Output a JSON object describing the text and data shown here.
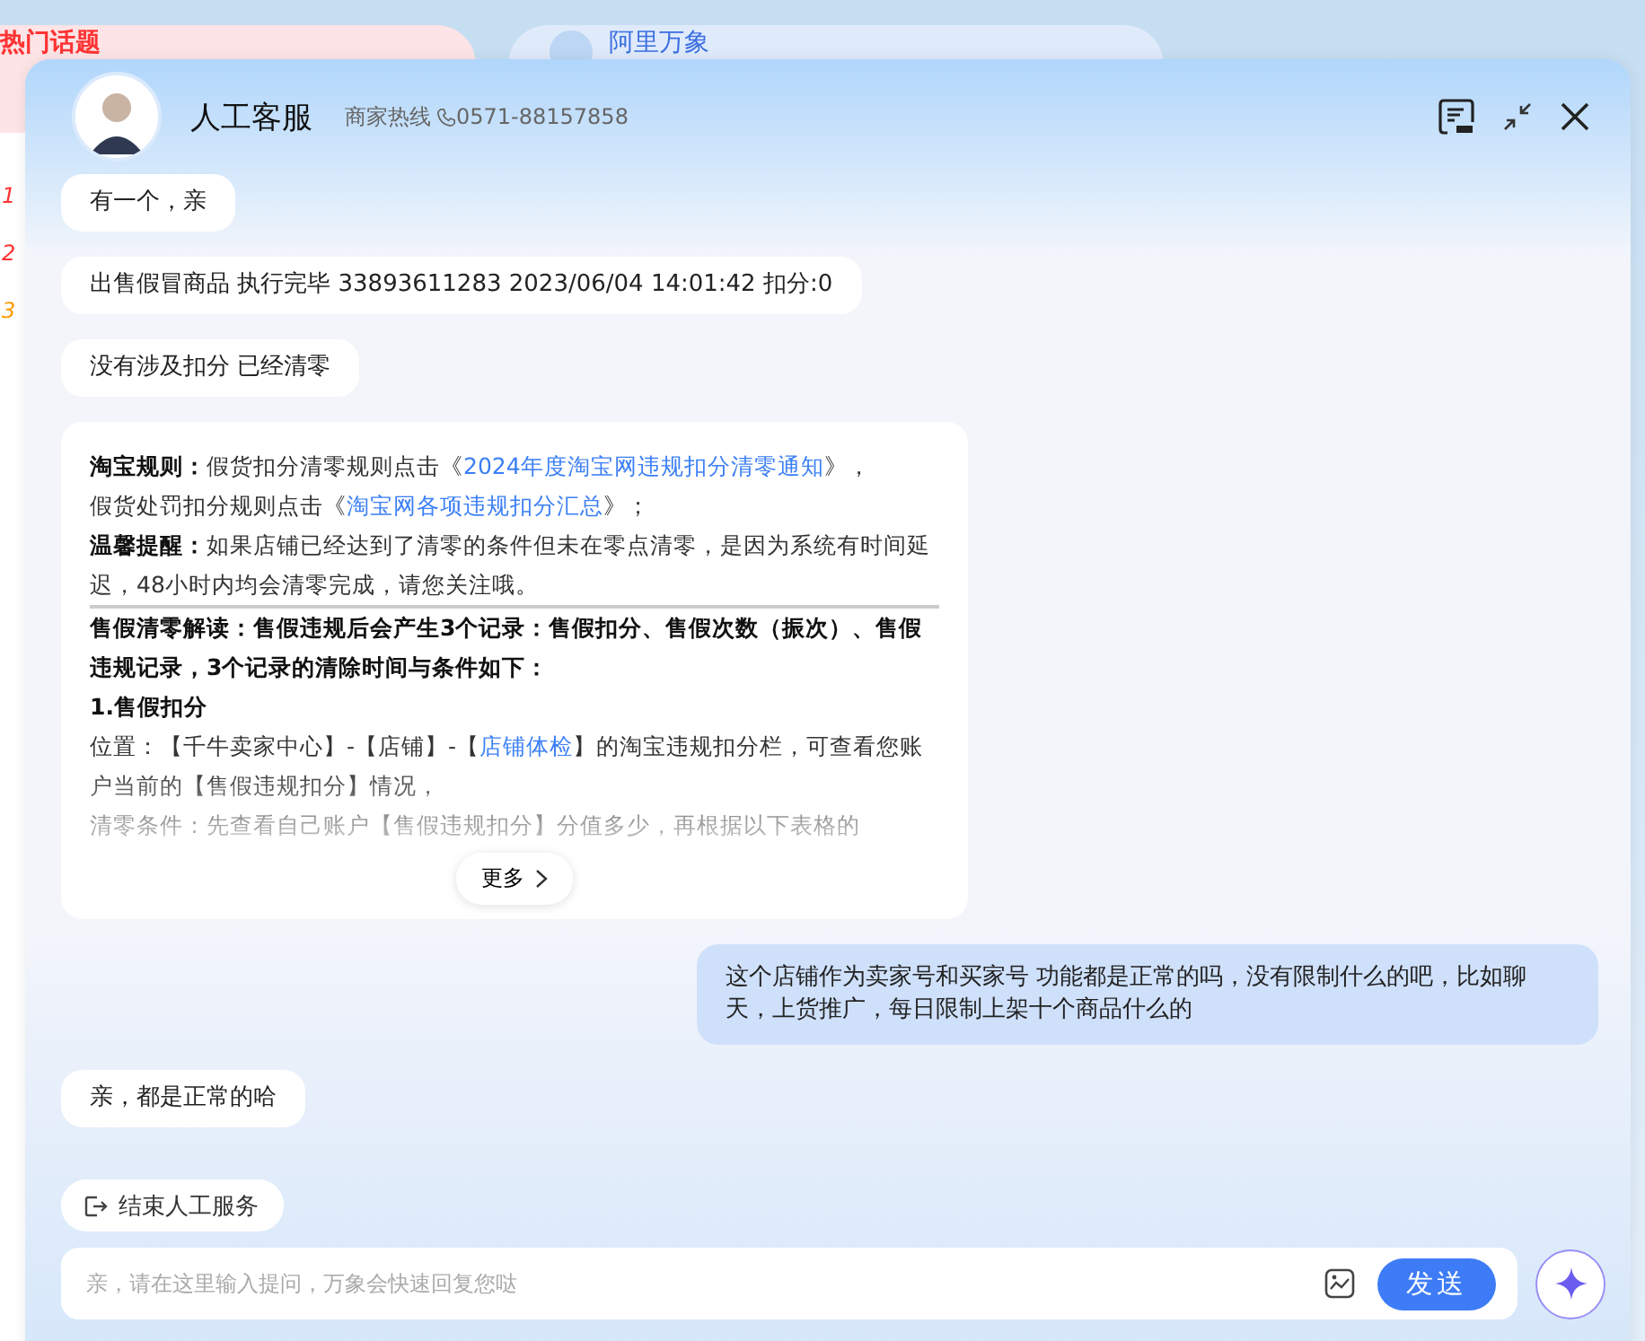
{
  "background": {
    "cards": [
      {
        "kind": "hot",
        "title": "热门话题"
      },
      {
        "kind": "brand",
        "title": "阿里万象"
      }
    ],
    "ranks": [
      "1",
      "2",
      "3"
    ]
  },
  "header": {
    "title": "人工客服",
    "hotline_label": "商家热线",
    "hotline_number": "0571-88157858"
  },
  "messages": [
    {
      "kind": "agent",
      "text": "有一个，亲"
    },
    {
      "kind": "agent",
      "text": "出售假冒商品 执行完毕 33893611283 2023/06/04 14:01:42 扣分:0"
    },
    {
      "kind": "agent",
      "text": "没有涉及扣分 已经清零"
    },
    {
      "kind": "card",
      "more": "更多",
      "blocks": [
        {
          "kind": "para",
          "segments": [
            {
              "kind": "bold",
              "text": "淘宝规则："
            },
            {
              "kind": "plain",
              "text": "假货扣分清零规则点击《"
            },
            {
              "kind": "link",
              "text": "2024年度淘宝网违规扣分清零通知"
            },
            {
              "kind": "plain",
              "text": "》，"
            }
          ]
        },
        {
          "kind": "para",
          "segments": [
            {
              "kind": "plain",
              "text": "假货处罚扣分规则点击《"
            },
            {
              "kind": "link",
              "text": "淘宝网各项违规扣分汇总"
            },
            {
              "kind": "plain",
              "text": "》；"
            }
          ]
        },
        {
          "kind": "para",
          "segments": [
            {
              "kind": "bold",
              "text": "温馨提醒："
            },
            {
              "kind": "plain",
              "text": "如果店铺已经达到了清零的条件但未在零点清零，是因为系统有时间延迟，48小时内均会清零完成，请您关注哦。"
            }
          ]
        },
        {
          "kind": "rule"
        },
        {
          "kind": "para",
          "segments": [
            {
              "kind": "bold",
              "text": "售假清零解读：售假违规后会产生3个记录：售假扣分、售假次数（振次）、售假违规记录，3个记录的清除时间与条件如下："
            }
          ]
        },
        {
          "kind": "para",
          "segments": [
            {
              "kind": "bold",
              "text": "1.售假扣分"
            }
          ]
        },
        {
          "kind": "para",
          "segments": [
            {
              "kind": "plain",
              "text": "位置：【千牛卖家中心】-【店铺】-【"
            },
            {
              "kind": "link",
              "text": "店铺体检"
            },
            {
              "kind": "plain",
              "text": "】的淘宝违规扣分栏，可查看您账户当前的【售假违规扣分】情况，"
            }
          ]
        },
        {
          "kind": "para",
          "segments": [
            {
              "kind": "plain",
              "text": "清零条件：先查看自己账户【售假违规扣分】分值多少，再根据以下表格的"
            }
          ]
        }
      ]
    },
    {
      "kind": "user",
      "text": "这个店铺作为卖家号和买家号 功能都是正常的吗，没有限制什么的吧，比如聊天，上货推广，每日限制上架十个商品什么的"
    },
    {
      "kind": "agent",
      "text": "亲，都是正常的哈"
    }
  ],
  "end_service": "结束人工服务",
  "input": {
    "placeholder": "亲，请在这里输入提问，万象会快速回复您哒"
  },
  "send": "发送"
}
